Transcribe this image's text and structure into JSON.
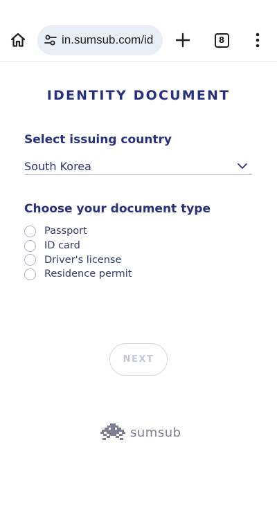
{
  "browser": {
    "url": "in.sumsub.com/id",
    "tab_count": "8",
    "icons": [
      "home-icon",
      "site-settings-icon",
      "plus-icon",
      "tab-switcher-icon",
      "more-vert-icon"
    ]
  },
  "page": {
    "title": "IDENTITY DOCUMENT",
    "country_section_label": "Select issuing country",
    "country_value": "South Korea",
    "doc_type_section_label": "Choose your document type",
    "doc_types": [
      "Passport",
      "ID card",
      "Driver's license",
      "Residence permit"
    ],
    "next_label": "NEXT",
    "footer_brand": "sumsub"
  },
  "colors": {
    "brand_navy": "#27307e",
    "radio_border": "#b3b6c8",
    "disabled_text": "#c5c8d6",
    "url_pill_bg": "#e9eef6"
  }
}
